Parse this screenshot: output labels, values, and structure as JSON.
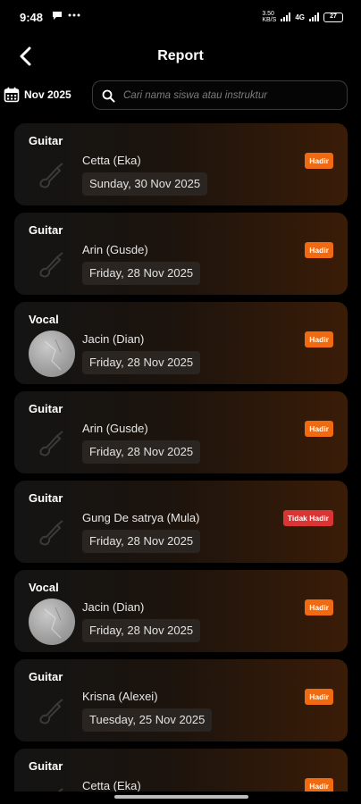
{
  "status_bar": {
    "time": "9:48",
    "speed": "3.50 KB/S",
    "network": "4G",
    "battery": "27"
  },
  "header": {
    "title": "Report",
    "back_icon": "chevron-left-icon"
  },
  "filter": {
    "month": "Nov 2025",
    "search_placeholder": "Cari nama siswa atau instruktur",
    "search_value": ""
  },
  "colors": {
    "status_present": "#f06a12",
    "status_absent": "#d93535"
  },
  "reports": [
    {
      "category": "Guitar",
      "name": "Cetta (Eka)",
      "date": "Sunday, 30 Nov 2025",
      "status": "Hadir",
      "thumb": "guitar-icon"
    },
    {
      "category": "Guitar",
      "name": "Arin (Gusde)",
      "date": "Friday, 28 Nov 2025",
      "status": "Hadir",
      "thumb": "guitar-icon"
    },
    {
      "category": "Vocal",
      "name": "Jacin (Dian)",
      "date": "Friday, 28 Nov 2025",
      "status": "Hadir",
      "thumb": "photo"
    },
    {
      "category": "Guitar",
      "name": "Arin (Gusde)",
      "date": "Friday, 28 Nov 2025",
      "status": "Hadir",
      "thumb": "guitar-icon"
    },
    {
      "category": "Guitar",
      "name": "Gung De satrya (Mula)",
      "date": "Friday, 28 Nov 2025",
      "status": "Tidak Hadir",
      "thumb": "guitar-icon"
    },
    {
      "category": "Vocal",
      "name": "Jacin (Dian)",
      "date": "Friday, 28 Nov 2025",
      "status": "Hadir",
      "thumb": "photo"
    },
    {
      "category": "Guitar",
      "name": "Krisna (Alexei)",
      "date": "Tuesday, 25 Nov 2025",
      "status": "Hadir",
      "thumb": "guitar-icon"
    },
    {
      "category": "Guitar",
      "name": "Cetta (Eka)",
      "date": "",
      "status": "Hadir",
      "thumb": "guitar-icon"
    }
  ]
}
